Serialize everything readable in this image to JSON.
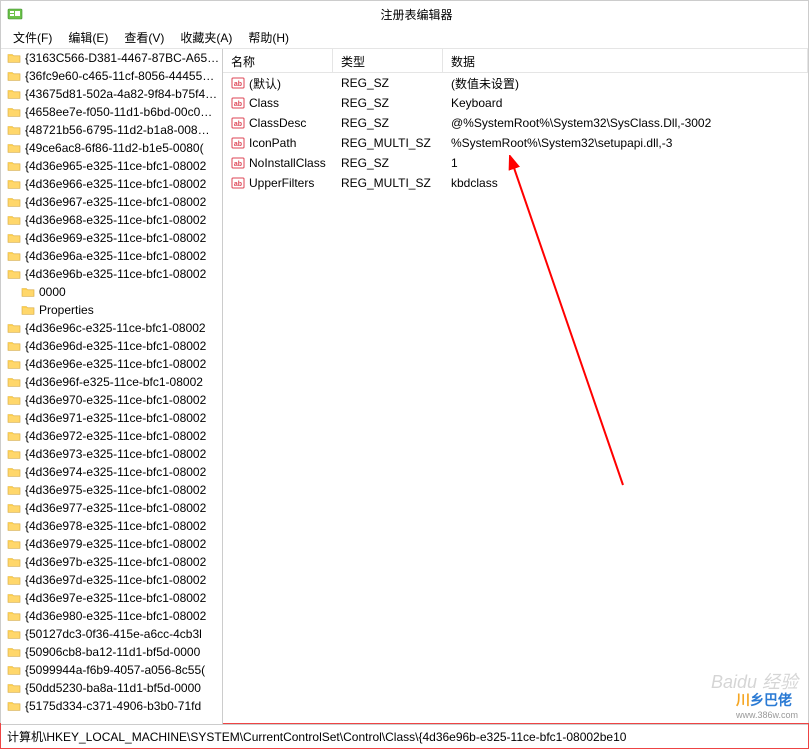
{
  "title": "注册表编辑器",
  "menu": {
    "file": "文件(F)",
    "edit": "编辑(E)",
    "view": "查看(V)",
    "favorites": "收藏夹(A)",
    "help": "帮助(H)"
  },
  "columns": {
    "name": "名称",
    "type": "类型",
    "data": "数据"
  },
  "tree": [
    "{3163C566-D381-4467-87BC-A65…",
    "{36fc9e60-c465-11cf-8056-44455…",
    "{43675d81-502a-4a82-9f84-b75f4…",
    "{4658ee7e-f050-11d1-b6bd-00c0…",
    "{48721b56-6795-11d2-b1a8-008…",
    "{49ce6ac8-6f86-11d2-b1e5-0080(",
    "{4d36e965-e325-11ce-bfc1-08002",
    "{4d36e966-e325-11ce-bfc1-08002",
    "{4d36e967-e325-11ce-bfc1-08002",
    "{4d36e968-e325-11ce-bfc1-08002",
    "{4d36e969-e325-11ce-bfc1-08002",
    "{4d36e96a-e325-11ce-bfc1-08002",
    "{4d36e96b-e325-11ce-bfc1-08002",
    "0000|indent",
    "Properties|indent",
    "{4d36e96c-e325-11ce-bfc1-08002",
    "{4d36e96d-e325-11ce-bfc1-08002",
    "{4d36e96e-e325-11ce-bfc1-08002",
    "{4d36e96f-e325-11ce-bfc1-08002",
    "{4d36e970-e325-11ce-bfc1-08002",
    "{4d36e971-e325-11ce-bfc1-08002",
    "{4d36e972-e325-11ce-bfc1-08002",
    "{4d36e973-e325-11ce-bfc1-08002",
    "{4d36e974-e325-11ce-bfc1-08002",
    "{4d36e975-e325-11ce-bfc1-08002",
    "{4d36e977-e325-11ce-bfc1-08002",
    "{4d36e978-e325-11ce-bfc1-08002",
    "{4d36e979-e325-11ce-bfc1-08002",
    "{4d36e97b-e325-11ce-bfc1-08002",
    "{4d36e97d-e325-11ce-bfc1-08002",
    "{4d36e97e-e325-11ce-bfc1-08002",
    "{4d36e980-e325-11ce-bfc1-08002",
    "{50127dc3-0f36-415e-a6cc-4cb3l",
    "{50906cb8-ba12-11d1-bf5d-0000",
    "{5099944a-f6b9-4057-a056-8c55(",
    "{50dd5230-ba8a-11d1-bf5d-0000",
    "{5175d334-c371-4906-b3b0-71fd"
  ],
  "values": [
    {
      "name": "(默认)",
      "type": "REG_SZ",
      "data": "(数值未设置)"
    },
    {
      "name": "Class",
      "type": "REG_SZ",
      "data": "Keyboard"
    },
    {
      "name": "ClassDesc",
      "type": "REG_SZ",
      "data": "@%SystemRoot%\\System32\\SysClass.Dll,-3002"
    },
    {
      "name": "IconPath",
      "type": "REG_MULTI_SZ",
      "data": "%SystemRoot%\\System32\\setupapi.dll,-3"
    },
    {
      "name": "NoInstallClass",
      "type": "REG_SZ",
      "data": "1"
    },
    {
      "name": "UpperFilters",
      "type": "REG_MULTI_SZ",
      "data": "kbdclass"
    }
  ],
  "statusbar": "计算机\\HKEY_LOCAL_MACHINE\\SYSTEM\\CurrentControlSet\\Control\\Class\\{4d36e96b-e325-11ce-bfc1-08002be10",
  "watermark": "Baidu 经验"
}
